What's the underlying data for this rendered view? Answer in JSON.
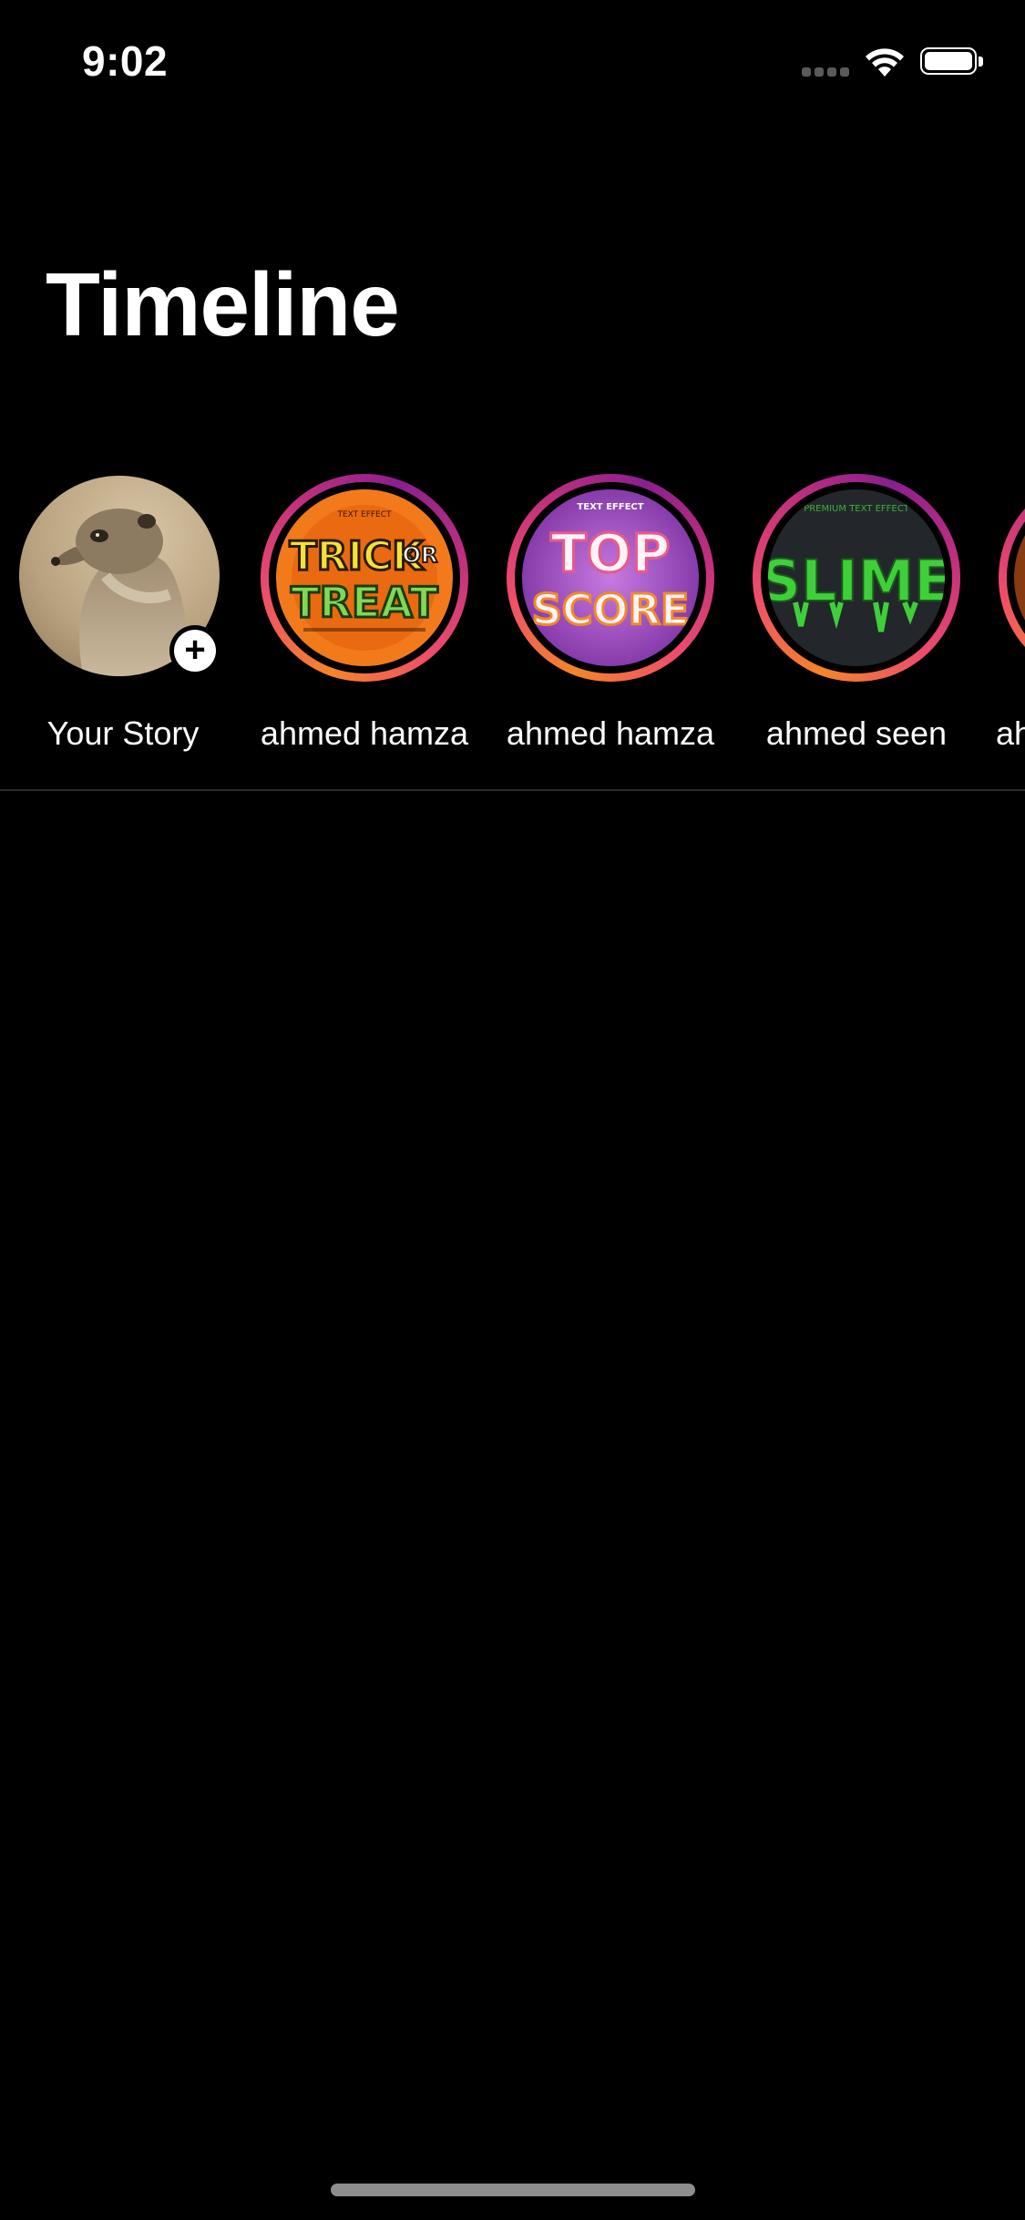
{
  "status_bar": {
    "time": "9:02",
    "icons": [
      "cellular-signal-icon",
      "wifi-icon",
      "battery-icon"
    ]
  },
  "page": {
    "title": "Timeline"
  },
  "stories": [
    {
      "label": "Your Story",
      "type": "own",
      "has_add_badge": true,
      "add_symbol": "+"
    },
    {
      "label": "ahmed hamza",
      "type": "story",
      "artwork_text": [
        "TRICK",
        "OR",
        "TREAT"
      ]
    },
    {
      "label": "ahmed hamza",
      "type": "story",
      "artwork_text": [
        "TOP",
        "SCORE"
      ]
    },
    {
      "label": "ahmed seen",
      "type": "story",
      "artwork_text": [
        "SLIME"
      ]
    },
    {
      "label": "ah",
      "type": "story",
      "partially_visible": true
    }
  ],
  "colors": {
    "background": "#000000",
    "text": "#ffffff",
    "story_ring_start": "#f58529",
    "story_ring_end": "#8a1f8f",
    "divider": "#2b2b2b"
  }
}
